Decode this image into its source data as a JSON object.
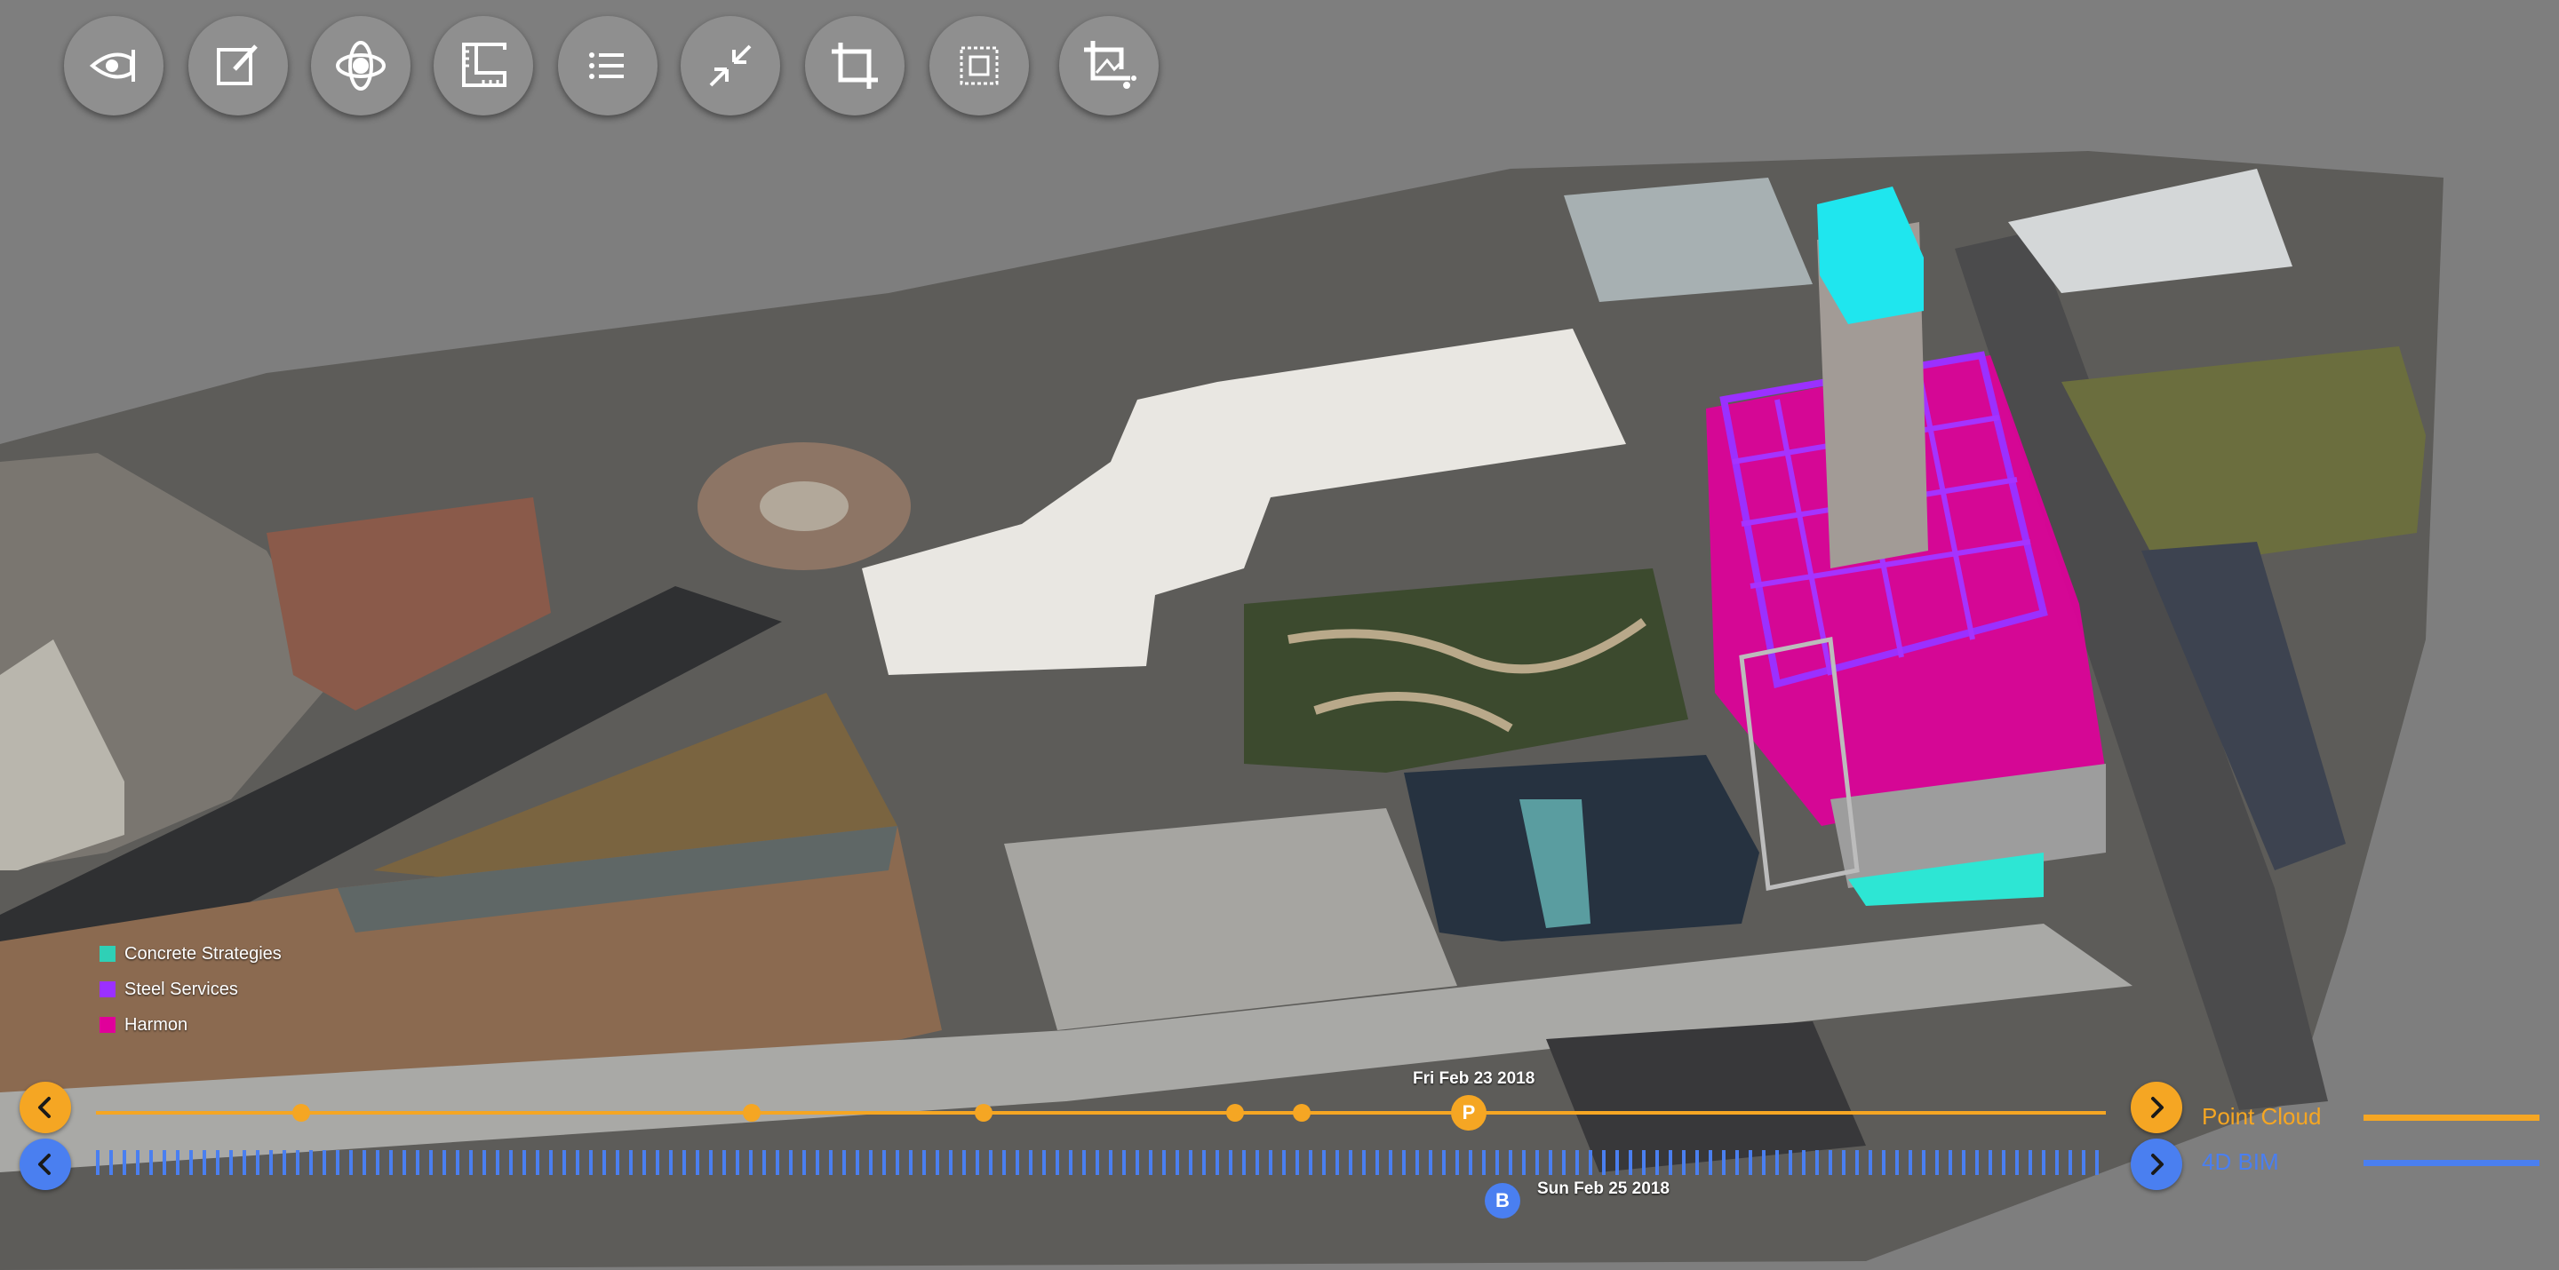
{
  "colors": {
    "background": "#7e7e7e",
    "toolbar_button": "#8f8f8f",
    "point_cloud": "#f5a623",
    "bim": "#4a7ff0",
    "concrete": "#2fd0b6",
    "steel": "#9b30ff",
    "harmon": "#e0009a"
  },
  "toolbar": [
    {
      "name": "visibility-tool-button",
      "icon": "eye-icon"
    },
    {
      "name": "annotate-tool-button",
      "icon": "edit-icon"
    },
    {
      "name": "orbit-tool-button",
      "icon": "orbit-icon"
    },
    {
      "name": "measure-tool-button",
      "icon": "ruler-icon"
    },
    {
      "name": "list-tool-button",
      "icon": "list-icon"
    },
    {
      "name": "collapse-tool-button",
      "icon": "collapse-icon"
    },
    {
      "name": "crop-tool-button",
      "icon": "crop-icon"
    },
    {
      "name": "section-box-tool-button",
      "icon": "section-box-icon"
    },
    {
      "name": "crop-share-tool-button",
      "icon": "crop-share-icon"
    }
  ],
  "legend": [
    {
      "label": "Concrete Strategies",
      "color": "#2fd0b6"
    },
    {
      "label": "Steel Services",
      "color": "#9b30ff"
    },
    {
      "label": "Harmon",
      "color": "#e0009a"
    }
  ],
  "timeline": {
    "point_cloud": {
      "label": "Point Cloud",
      "selected_date": "Fri Feb 23 2018",
      "handle_letter": "P"
    },
    "bim": {
      "label": "4D BIM",
      "selected_date": "Sun Feb 25 2018",
      "handle_letter": "B"
    }
  }
}
